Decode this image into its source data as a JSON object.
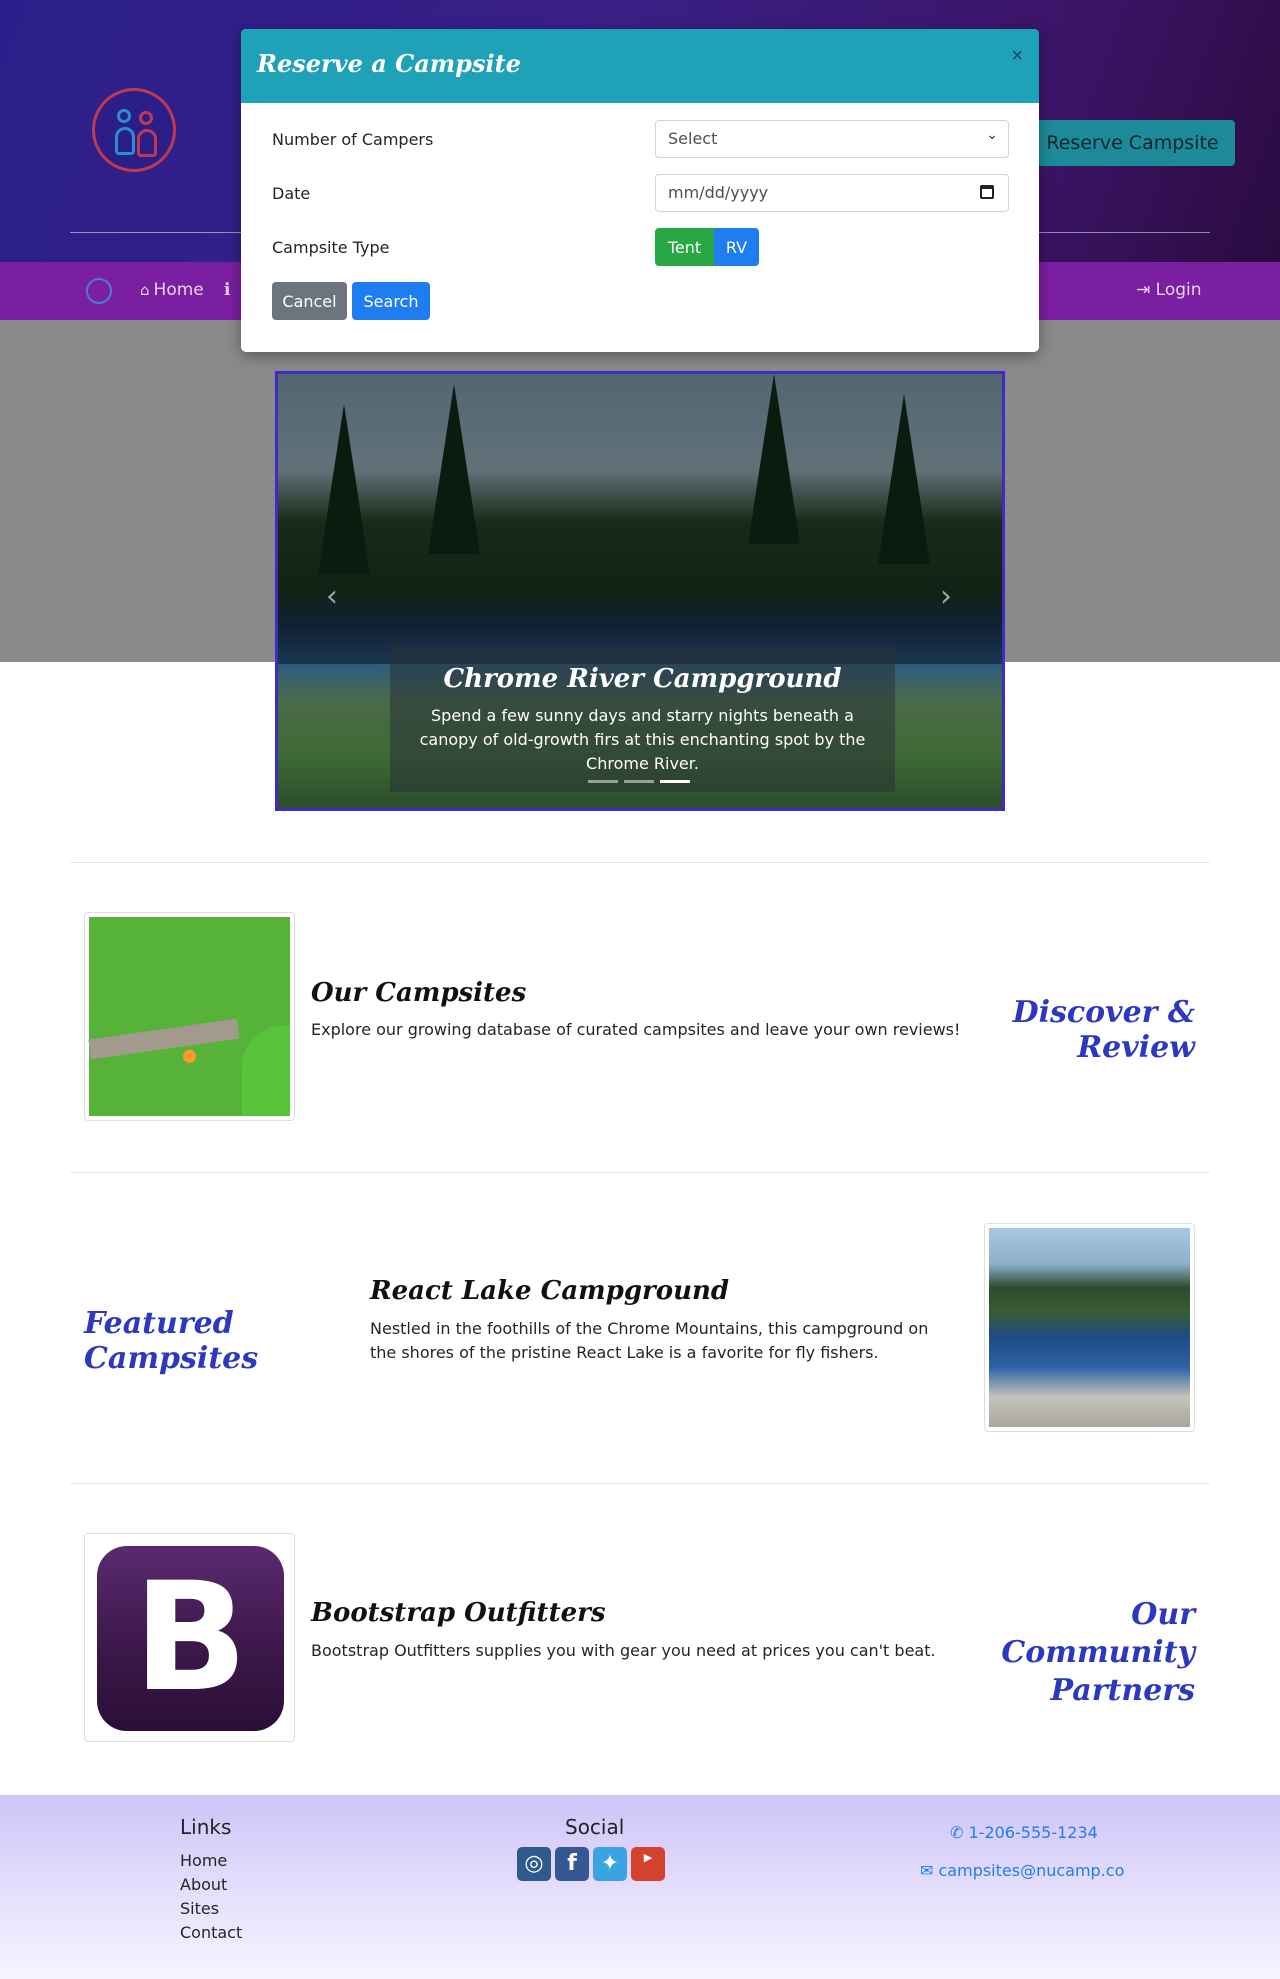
{
  "header": {
    "reserve_button": "Reserve Campsite"
  },
  "nav": {
    "home": "Home",
    "login": "Login"
  },
  "carousel": {
    "title": "Chrome River Campground",
    "text": "Spend a few sunny days and starry nights beneath a canopy of old-growth firs at this enchanting spot by the Chrome River.",
    "active_index": 3,
    "count": 3
  },
  "modal": {
    "title": "Reserve a Campsite",
    "close": "×",
    "campers_label": "Number of Campers",
    "campers_value": "Select",
    "date_label": "Date",
    "date_placeholder": "mm/dd/yyyy",
    "type_label": "Campsite Type",
    "tent": "Tent",
    "rv": "RV",
    "cancel": "Cancel",
    "search": "Search"
  },
  "rows": {
    "campsites": {
      "title": "Our Campsites",
      "text": "Explore our growing database of curated campsites and leave your own reviews!",
      "side": "Discover & Review"
    },
    "featured": {
      "side": "Featured Campsites",
      "title": "React Lake Campground",
      "text": "Nestled in the foothills of the Chrome Mountains, this campground on the shores of the pristine React Lake is a favorite for fly fishers."
    },
    "partners": {
      "title": "Bootstrap Outfitters",
      "text": "Bootstrap Outfitters supplies you with gear you need at prices you can't beat.",
      "side": "Our Community Partners",
      "logo_letter": "B"
    }
  },
  "footer": {
    "links_heading": "Links",
    "links": [
      "Home",
      "About",
      "Sites",
      "Contact"
    ],
    "social_heading": "Social",
    "phone": "1-206-555-1234",
    "email": "campsites@nucamp.co"
  }
}
